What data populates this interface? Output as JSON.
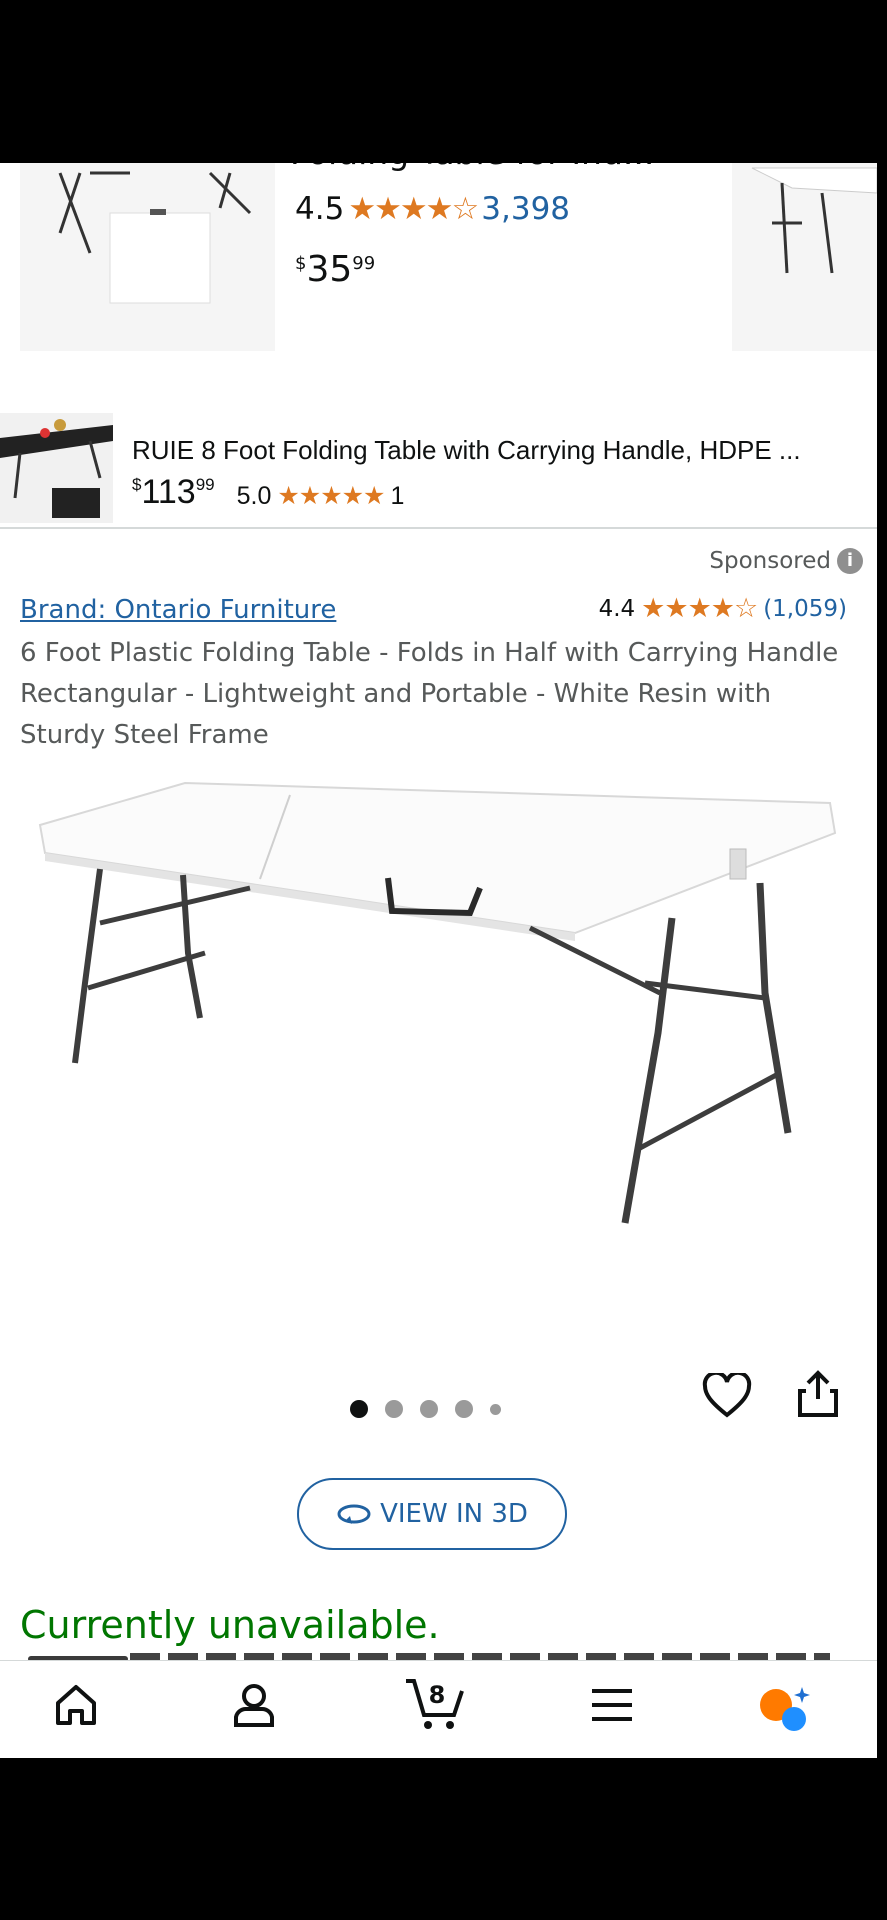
{
  "carousel_top": {
    "title_cut": "Folding Table for Ind...",
    "rating": "4.5",
    "review_count": "3,398",
    "price_symbol": "$",
    "price_whole": "35",
    "price_fraction": "99"
  },
  "ad_row": {
    "title": "RUIE 8 Foot Folding Table with Carrying Handle, HDPE ...",
    "price_symbol": "$",
    "price_whole": "113",
    "price_fraction": "99",
    "rating": "5.0",
    "review_count": "1"
  },
  "product": {
    "sponsored": "Sponsored",
    "brand": "Brand: Ontario Furniture",
    "rating": "4.4",
    "review_count": "(1,059)",
    "title": "6 Foot Plastic Folding Table - Folds in Half with Carrying Handle Rectangular - Lightweight and Portable - White Resin with Sturdy Steel Frame",
    "image_count": 5,
    "active_image_index": 0,
    "view_3d": "VIEW IN 3D",
    "availability": "Currently unavailable."
  },
  "bottom_nav": {
    "cart_count": "8",
    "items": [
      "home-icon",
      "account-icon",
      "cart-icon",
      "menu-icon",
      "rufus-icon"
    ]
  },
  "colors": {
    "link": "#2162A1",
    "star": "#DE7921",
    "available": "#007600"
  }
}
